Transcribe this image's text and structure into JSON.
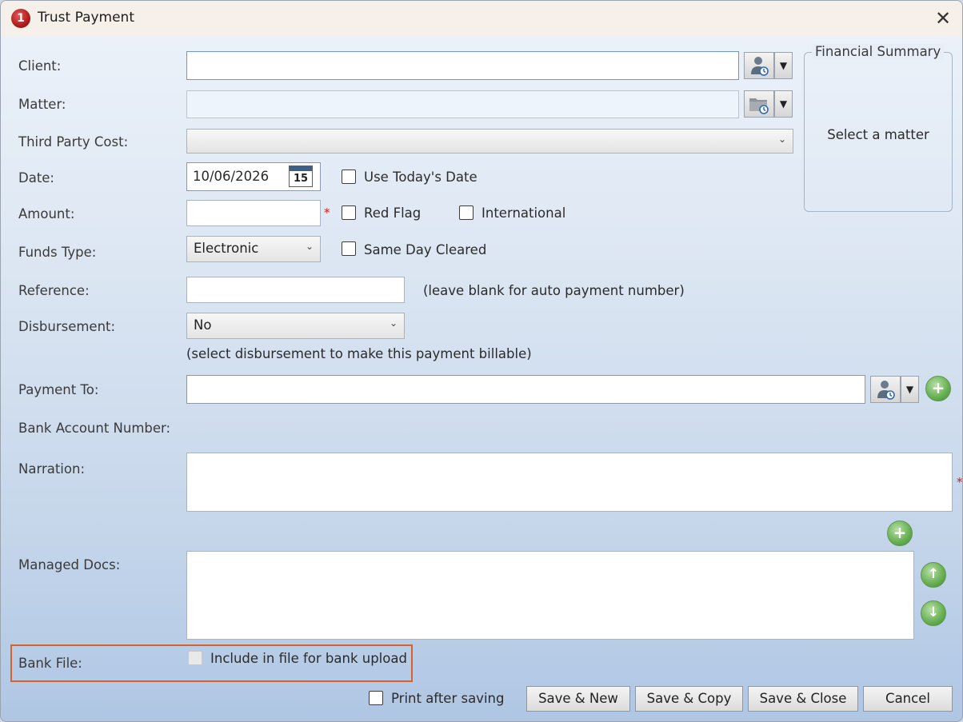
{
  "window": {
    "title": "Trust Payment"
  },
  "fields": {
    "client_label": "Client:",
    "matter_label": "Matter:",
    "third_party_label": "Third Party Cost:",
    "date_label": "Date:",
    "date_value": "10/06/2026",
    "calendar_day": "15",
    "use_today_label": "Use Today's Date",
    "amount_label": "Amount:",
    "required_mark": "*",
    "red_flag_label": "Red Flag",
    "international_label": "International",
    "funds_type_label": "Funds Type:",
    "funds_type_value": "Electronic",
    "same_day_label": "Same Day Cleared",
    "reference_label": "Reference:",
    "reference_hint": "(leave blank for auto payment number)",
    "disbursement_label": "Disbursement:",
    "disbursement_value": "No",
    "disbursement_hint": "(select disbursement to make this payment billable)",
    "payment_to_label": "Payment To:",
    "bank_account_label": "Bank Account Number:",
    "narration_label": "Narration:",
    "managed_docs_label": "Managed Docs:",
    "bank_file_label": "Bank File:",
    "bank_upload_label": "Include in file for bank upload"
  },
  "financial_summary": {
    "title": "Financial Summary",
    "message": "Select a matter"
  },
  "footer": {
    "print_label": "Print after saving",
    "save_new": "Save & New",
    "save_copy": "Save & Copy",
    "save_close": "Save & Close",
    "cancel": "Cancel"
  }
}
